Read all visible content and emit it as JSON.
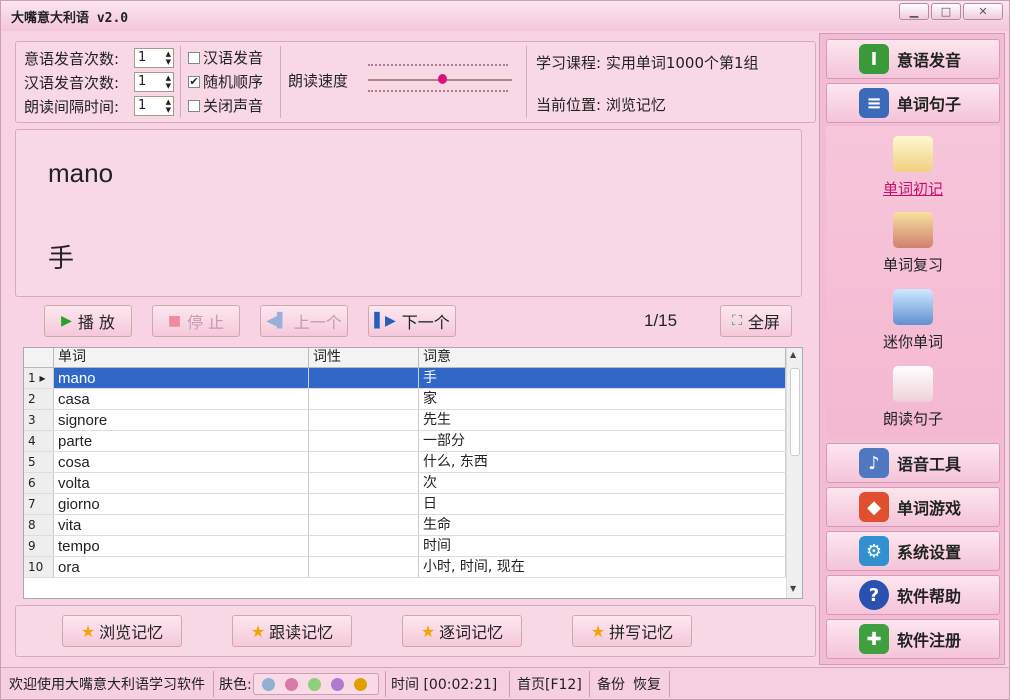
{
  "window": {
    "title": "大嘴意大利语 v2.0",
    "min": "▁",
    "max": "□",
    "close": "✕"
  },
  "settings": {
    "italian_count_label": "意语发音次数:",
    "italian_count": "1",
    "chinese_count_label": "汉语发音次数:",
    "chinese_count": "1",
    "interval_label": "朗读间隔时间:",
    "interval": "1",
    "chk_chinese": {
      "label": "汉语发音",
      "checked": false
    },
    "chk_random": {
      "label": "随机顺序",
      "checked": true
    },
    "chk_mute": {
      "label": "关闭声音",
      "checked": false
    },
    "speed_label": "朗读速度",
    "course": "学习课程: 实用单词1000个第1组",
    "position": "当前位置: 浏览记忆"
  },
  "display": {
    "word": "mano",
    "meaning": "手"
  },
  "controls": {
    "play": "播 放",
    "stop": "停 止",
    "prev": "上一个",
    "next": "下一个",
    "counter": "1/15",
    "fullscreen": "全屏"
  },
  "table": {
    "headers": [
      "单词",
      "词性",
      "词意"
    ],
    "rows": [
      {
        "n": "1",
        "word": "mano",
        "pos": "",
        "meaning": "手"
      },
      {
        "n": "2",
        "word": "casa",
        "pos": "",
        "meaning": "家"
      },
      {
        "n": "3",
        "word": "signore",
        "pos": "",
        "meaning": "先生"
      },
      {
        "n": "4",
        "word": "parte",
        "pos": "",
        "meaning": "一部分"
      },
      {
        "n": "5",
        "word": "cosa",
        "pos": "",
        "meaning": "什么, 东西"
      },
      {
        "n": "6",
        "word": "volta",
        "pos": "",
        "meaning": "次"
      },
      {
        "n": "7",
        "word": "giorno",
        "pos": "",
        "meaning": "日"
      },
      {
        "n": "8",
        "word": "vita",
        "pos": "",
        "meaning": "生命"
      },
      {
        "n": "9",
        "word": "tempo",
        "pos": "",
        "meaning": "时间"
      },
      {
        "n": "10",
        "word": "ora",
        "pos": "",
        "meaning": "小时, 时间, 现在"
      }
    ]
  },
  "modes": {
    "browse": "浏览记忆",
    "follow": "跟读记忆",
    "word_by_word": "逐词记忆",
    "spelling": "拼写记忆"
  },
  "sidebar": {
    "italian_pron": "意语发音",
    "word_sentence": "单词句子",
    "sub": {
      "first": "单词初记",
      "review": "单词复习",
      "mini": "迷你单词",
      "read_sentence": "朗读句子"
    },
    "voice_tools": "语音工具",
    "word_games": "单词游戏",
    "settings": "系统设置",
    "help": "软件帮助",
    "register": "软件注册"
  },
  "status": {
    "welcome": "欢迎使用大嘴意大利语学习软件",
    "skin_label": "肤色:",
    "skin_colors": [
      "#8fb0d0",
      "#d77aa8",
      "#8fcf7a",
      "#b07ad0",
      "#e0a000"
    ],
    "time": "时间 [00:02:21]",
    "home": "首页[F12]",
    "backup": "备份",
    "restore": "恢复"
  }
}
